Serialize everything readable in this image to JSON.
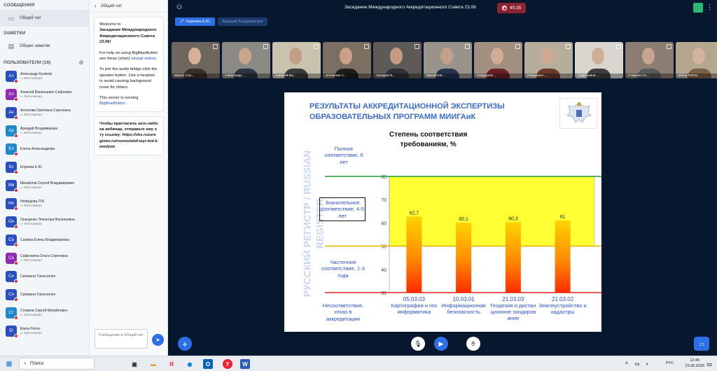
{
  "sidebar": {
    "messages_title": "СООБЩЕНИЯ",
    "public_chat": "Общий чат",
    "notes_title": "ЗАМЕТКИ",
    "shared_notes": "Общие заметки",
    "users_title": "ПОЛЬЗОВАТЕЛИ (16)",
    "users": [
      {
        "initials": "Ал",
        "name": "Александр Куликов",
        "sub": "Веб-камера",
        "color": "#2a4fbf"
      },
      {
        "initials": "Ал",
        "name": "Алексей Васильевич Сафонкин",
        "sub": "Веб-камера",
        "color": "#8e2bb3"
      },
      {
        "initials": "Ан",
        "name": "Антонова Светлана Сергеевна",
        "sub": "Веб-камера",
        "color": "#2a4fbf"
      },
      {
        "initials": "Ар",
        "name": "Аркадий Владимирцев",
        "sub": "Веб-камера",
        "color": "#1e88c9"
      },
      {
        "initials": "Ел",
        "name": "Елена Александрова",
        "sub": "",
        "color": "#1e88c9"
      },
      {
        "initials": "Ко",
        "name": "Корнева Е.Ю.",
        "sub": "",
        "color": "#2a4fbf"
      },
      {
        "initials": "Ми",
        "name": "Михайлов Сергей Владимирович",
        "sub": "Веб-камера",
        "color": "#2a4fbf"
      },
      {
        "initials": "Не",
        "name": "Нефедова Л.В.",
        "sub": "Веб-камера",
        "color": "#2a4fbf"
      },
      {
        "initials": "Он",
        "name": "Онищенко Элеонора Васильевна",
        "sub": "Веб-камера",
        "color": "#2a4fbf"
      },
      {
        "initials": "Са",
        "name": "Сажина Елена Владимировна",
        "sub": "",
        "color": "#2a4fbf"
      },
      {
        "initials": "Са",
        "name": "Сафонкина Ольга Сергеевна",
        "sub": "Веб-камера",
        "color": "#8e2bb3"
      },
      {
        "initials": "Сн",
        "name": "Сиюмана Таносхолич",
        "sub": "",
        "color": "#2a4fbf"
      },
      {
        "initials": "Сн",
        "name": "Сиюмана Таносхолич",
        "sub": "",
        "color": "#2a4fbf"
      },
      {
        "initials": "Ст",
        "name": "Стажков Сергей Михайлович",
        "sub": "Веб-камера",
        "color": "#1e88c9"
      },
      {
        "initials": "El",
        "name": "Elena Petrov",
        "sub": "Веб-камера",
        "color": "#2a4fbf"
      }
    ]
  },
  "chat": {
    "title": "Общий чат",
    "welcome_1": "Welcome to",
    "welcome_2": "Заседание Международного Аккредитационного Совета 23.06!",
    "help_1": "For help on using BigBlueButton see these (short)",
    "help_link": "tutorial videos",
    "help_2": ".",
    "audio": "To join the audio bridge click the speaker button. Use a headset to avoid causing background noise for others.",
    "server_1": "This server is running",
    "server_link": "BigBlueButton",
    "server_2": ".",
    "invite": "Чтобы пригласить кого-либо на вебинар, отправьте ему эту ссылку: https://vks.russregister.ru/rooms/wb4-wyr-bnt-kmm/join",
    "input_placeholder": "Сообщение в Общий чат"
  },
  "topbar": {
    "meeting_title": "Заседание Международного Аккредитационного Совета 23.06",
    "timer": "45:35"
  },
  "talking": [
    {
      "name": "Корнева Е.Ю.",
      "active": true
    },
    {
      "name": "Аркадий Владимирцев",
      "active": false
    }
  ],
  "videos": [
    {
      "name": "Ирина Сал...",
      "bg": "#6f665e",
      "face": "#d6b09a",
      "body": "#3b2f2a"
    },
    {
      "name": "Александр...",
      "bg": "#8b8a84",
      "face": "#c9a48e",
      "body": "#2b3544"
    },
    {
      "name": "Алексей Ва...",
      "bg": "#c8c2ae",
      "face": "#c39d86",
      "body": "#3a3a3a"
    },
    {
      "name": "Антонова С...",
      "bg": "#7d6e62",
      "face": "#caa08a",
      "body": "#1e1e1e"
    },
    {
      "name": "Аркадий В...",
      "bg": "#5e5a57",
      "face": "#c79b82",
      "body": "#2f2f36"
    },
    {
      "name": "Михайлов ...",
      "bg": "#9a938c",
      "face": "#c3a08a",
      "body": "#23344f"
    },
    {
      "name": "Нефедова ...",
      "bg": "#a38f80",
      "face": "#d2ad96",
      "body": "#6b2025"
    },
    {
      "name": "Онищенко ...",
      "bg": "#b7ad9d",
      "face": "#cfa891",
      "body": "#6a3a2a"
    },
    {
      "name": "Сафонкина ...",
      "bg": "#d9d5cf",
      "face": "#cfae98",
      "body": "#3d3d3d"
    },
    {
      "name": "Стажков Се...",
      "bg": "#8c7d72",
      "face": "#c9a48e",
      "body": "#5a5a5a"
    },
    {
      "name": "Elena Petrov",
      "bg": "#b5a68f",
      "face": "#d4b39c",
      "body": "#7a6048"
    }
  ],
  "slide": {
    "title_line1": "РЕЗУЛЬТАТЫ АККРЕДИТАЦИОННОЙ ЭКСПЕРТИЗЫ",
    "title_line2": "ОБРАЗОВАТЕЛЬНЫХ ПРОГРАММ МИИГАиК",
    "watermark_1": "РУССКИЙ РЕГИСТР / RUSSIAN",
    "watermark_2": "REGISTER",
    "degree_1": "Степень соответствия",
    "degree_2": "требованиям, %",
    "label_full": "Полное соответствие, 6 лет",
    "label_significant": "Значительное соответствие, 4-5 лет",
    "label_partial": "Частичное соответствие, 1-3 года",
    "label_none": "Несоответствие, отказ в аккредитации"
  },
  "chart_data": {
    "type": "bar",
    "categories": [
      "05.03.03 Картография и геоинформатика",
      "10.03.01 Информационная безопасность",
      "21.03.03 Геодезия и дистанционное зондирование",
      "21.03.02 Землеустройство и кадастры"
    ],
    "category_codes": [
      "05.03.03",
      "10.03.01",
      "21.03.03",
      "21.03.02"
    ],
    "category_names": [
      "Картография и геоинформатика",
      "Информационная безопасность",
      "Геодезия и дистанционное зондирование",
      "Землеустройство и кадастры"
    ],
    "values": [
      62.7,
      60.1,
      60.3,
      61
    ],
    "value_labels": [
      "62,7",
      "60,1",
      "60,3",
      "61"
    ],
    "ylim": [
      30,
      80
    ],
    "yticks": [
      30,
      40,
      50,
      60,
      70,
      80
    ],
    "threshold_lines": [
      {
        "value": 80,
        "color": "#1a9a3a"
      },
      {
        "value": 50,
        "color": "#e8b400"
      },
      {
        "value": 30,
        "color": "#e02020"
      }
    ],
    "band_color": "#ffff33",
    "grid": false
  },
  "taskbar": {
    "search_label": "Поиск",
    "lang": "РУС",
    "time": "12:45",
    "date": "23.06.2026"
  }
}
